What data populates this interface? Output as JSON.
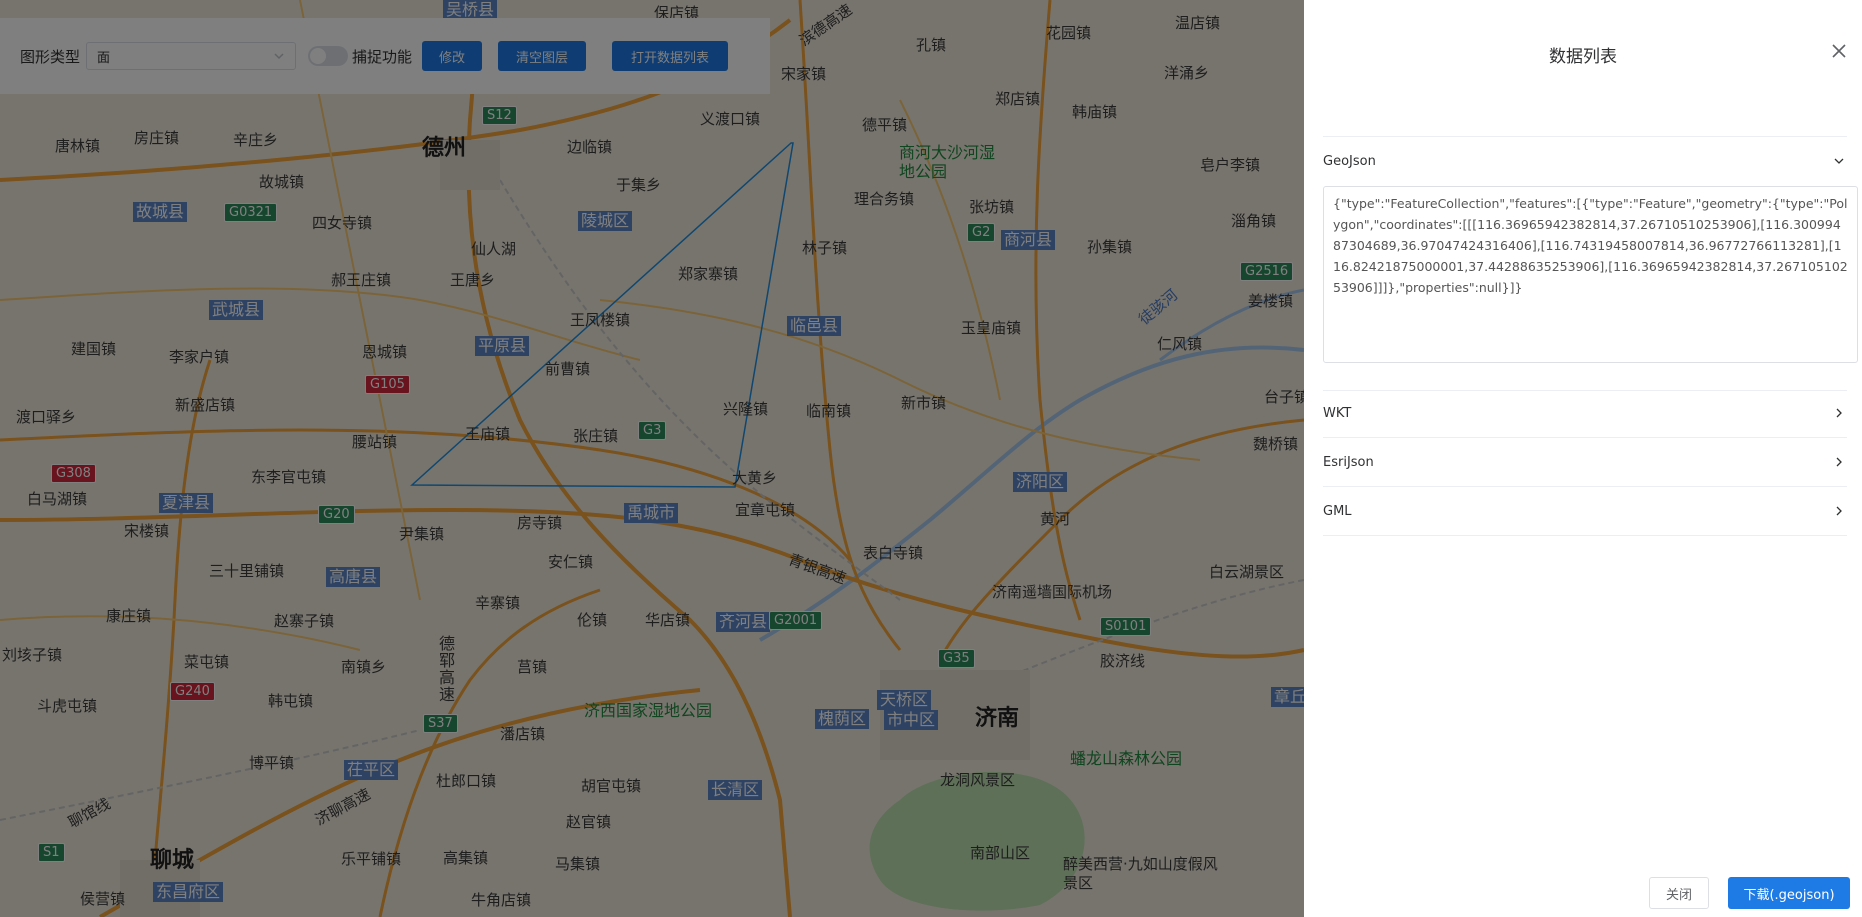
{
  "toolbar": {
    "shape_type_label": "图形类型",
    "shape_type_value": "面",
    "snap_label": "捕捉功能",
    "modify_button": "修改",
    "clear_layer_button": "清空图层",
    "open_list_button": "打开数据列表"
  },
  "drawer": {
    "title": "数据列表",
    "sections": [
      {
        "label": "GeoJson",
        "expanded": true
      },
      {
        "label": "WKT",
        "expanded": false
      },
      {
        "label": "EsriJson",
        "expanded": false
      },
      {
        "label": "GML",
        "expanded": false
      }
    ],
    "geojson_text": "{\"type\":\"FeatureCollection\",\"features\":[{\"type\":\"Feature\",\"geometry\":{\"type\":\"Polygon\",\"coordinates\":[[[116.36965942382814,37.26710510253906],[116.30099487304689,36.97047424316406],[116.74319458007814,36.96772766113281],[116.82421875000001,37.44288635253906],[116.36965942382814,37.26710510253906]]]},\"properties\":null}]}",
    "close_button": "关闭",
    "download_button": "下载(.geojson)"
  },
  "map": {
    "cities": [
      "德州",
      "济南",
      "聊城"
    ],
    "districts": [
      "吴桥县",
      "陵城区",
      "故城县",
      "武城县",
      "平原县",
      "临邑县",
      "商河县",
      "夏津县",
      "禹城市",
      "高唐县",
      "济阳区",
      "齐河县",
      "天桥区",
      "槐荫区",
      "市中区",
      "茌平区",
      "长清区",
      "东昌府区",
      "章丘"
    ],
    "towns": [
      "保店镇",
      "花园镇",
      "温店镇",
      "孔镇",
      "郑店镇",
      "洋涌乡",
      "韩庙镇",
      "唐林镇",
      "房庄镇",
      "辛庄乡",
      "边临镇",
      "义渡口镇",
      "德平镇",
      "宋家镇",
      "故城镇",
      "四女寺镇",
      "于集乡",
      "理合务镇",
      "张坊镇",
      "孙集镇",
      "皂户李镇",
      "淄角镇",
      "仙人湖",
      "郝王庄镇",
      "王唐乡",
      "郑家寨镇",
      "林子镇",
      "姜楼镇",
      "王凤楼镇",
      "玉皇庙镇",
      "仁风镇",
      "建国镇",
      "李家户镇",
      "恩城镇",
      "前曹镇",
      "台子镇",
      "渡口驿乡",
      "新盛店镇",
      "兴隆镇",
      "临南镇",
      "新市镇",
      "魏桥镇",
      "腰站镇",
      "王庙镇",
      "张庄镇",
      "白马湖镇",
      "东李官屯镇",
      "大黄乡",
      "宜章屯镇",
      "黄河",
      "宋楼镇",
      "尹集镇",
      "房寺镇",
      "表白寺镇",
      "白云湖景区",
      "三十里铺镇",
      "安仁镇",
      "济南遥墙国际机场",
      "康庄镇",
      "赵寨子镇",
      "辛寨镇",
      "伦镇",
      "华店镇",
      "刘垓子镇",
      "菜屯镇",
      "南镇乡",
      "莒镇",
      "胶济线",
      "斗虎屯镇",
      "韩屯镇",
      "潘店镇",
      "济西国家湿地公园",
      "蟠龙山森林公园",
      "博平镇",
      "杜郎口镇",
      "胡官屯镇",
      "龙洞风景区",
      "赵官镇",
      "乐平铺镇",
      "高集镇",
      "马集镇",
      "南部山区",
      "侯营镇",
      "牛角店镇",
      "醉美西营·九如山度假风景区",
      "商河大沙河湿地公园",
      "徒骇河",
      "青银高速",
      "济聊高速",
      "德郓高速",
      "聊馆线",
      "滨德高速"
    ],
    "road_shields": [
      "S12",
      "G0321",
      "G2",
      "G2516",
      "G105",
      "G3",
      "G308",
      "G20",
      "G2001",
      "G35",
      "S0101",
      "G240",
      "S37",
      "S1"
    ]
  }
}
